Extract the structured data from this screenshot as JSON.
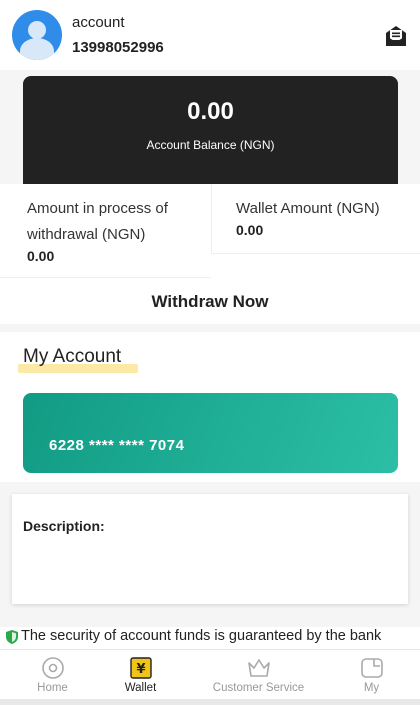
{
  "header": {
    "account_label": "account",
    "phone": "13998052996"
  },
  "balance": {
    "value": "0.00",
    "label": "Account Balance (NGN)"
  },
  "stats": {
    "withdrawal_label": "Amount in process of withdrawal (NGN)",
    "withdrawal_value": "0.00",
    "wallet_label": "Wallet Amount (NGN)",
    "wallet_value": "0.00"
  },
  "withdraw_button": "Withdraw Now",
  "my_account": {
    "title": "My Account",
    "card_number": "6228 **** **** 7074",
    "card_gradient": [
      "#119b84",
      "#2cbfa6"
    ]
  },
  "description": {
    "label": "Description:"
  },
  "security_notice": "The security of account funds is guaranteed by the bank",
  "tabbar": {
    "tabs": [
      {
        "label": "Home",
        "icon": "home-icon",
        "active": false
      },
      {
        "label": "Wallet",
        "icon": "wallet-icon",
        "active": true
      },
      {
        "label": "Customer Service",
        "icon": "crown-icon",
        "active": false
      },
      {
        "label": "My",
        "icon": "profile-icon",
        "active": false
      }
    ]
  },
  "colors": {
    "balance_card": "#222222",
    "highlight": "#fce9a6",
    "active_tab_icon": "#f0c419",
    "shield": "#2aa84a"
  }
}
